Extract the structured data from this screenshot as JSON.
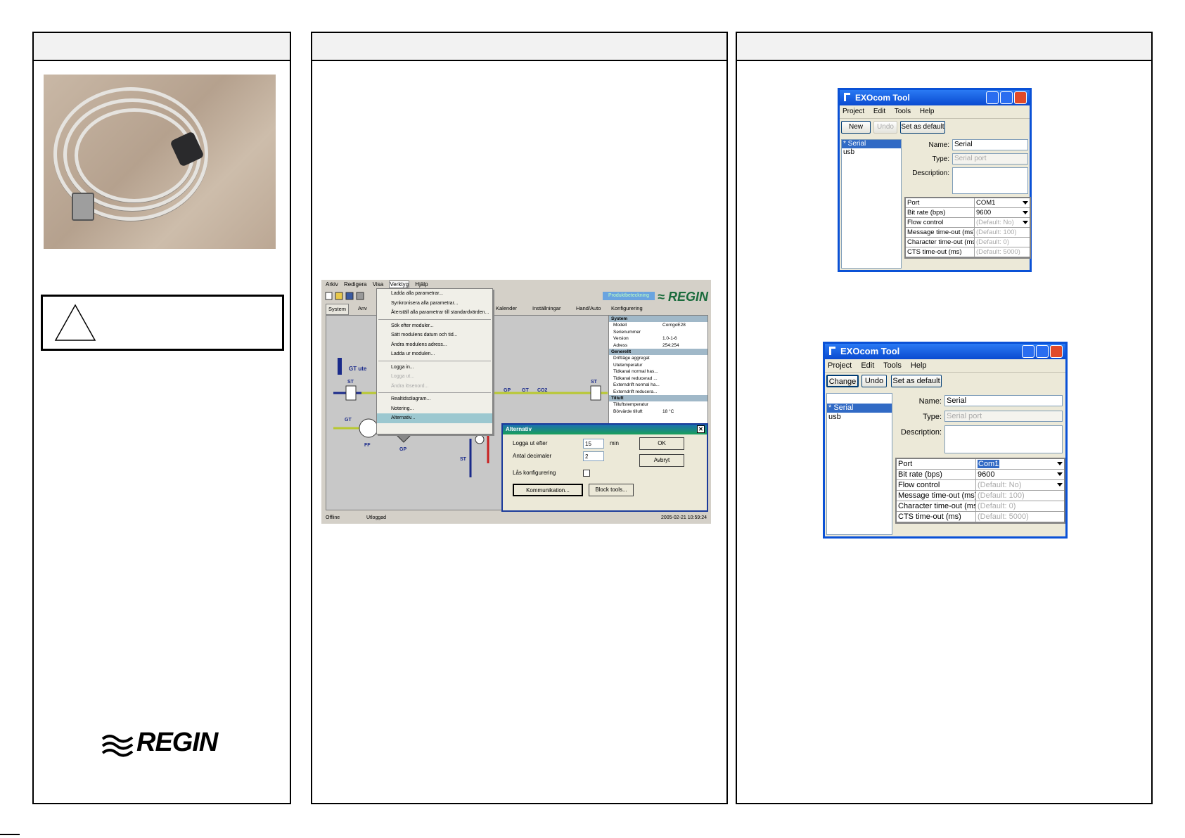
{
  "logo": {
    "text": "REGIN"
  },
  "software": {
    "menu": [
      "Arkiv",
      "Redigera",
      "Visa",
      "Verktyg",
      "Hjälp"
    ],
    "brand_tag": "Produktbeteckning",
    "brand": "REGIN",
    "tabs": [
      "System",
      "Anv",
      "Kalender",
      "Inställningar",
      "Hand/Auto",
      "Konfigurering"
    ],
    "dropdown": [
      {
        "label": "Ladda alla parametrar...",
        "disabled": false
      },
      {
        "label": "Synkronisera alla parametrar...",
        "disabled": false
      },
      {
        "label": "Återställ alla parametrar till standardvärden...",
        "disabled": false
      },
      {
        "label": "Sök efter moduler...",
        "disabled": false
      },
      {
        "label": "Sätt modulens datum och tid...",
        "disabled": false
      },
      {
        "label": "Ändra modulens adress...",
        "disabled": false
      },
      {
        "label": "Ladda ur modulen...",
        "disabled": false
      },
      {
        "label": "Logga in...",
        "disabled": false
      },
      {
        "label": "Logga ut...",
        "disabled": true
      },
      {
        "label": "Ändra lösenord...",
        "disabled": true
      },
      {
        "label": "Realtidsdiagram...",
        "disabled": false
      },
      {
        "label": "Notering...",
        "disabled": false
      },
      {
        "label": "Alternativ...",
        "disabled": false
      }
    ],
    "sidebar": {
      "system_header": "System",
      "system_rows": [
        [
          "Modell",
          "CorrigoE28"
        ],
        [
          "Serienummer",
          ""
        ],
        [
          "Version",
          "1.0-1-6"
        ],
        [
          "Adress",
          "254:254"
        ]
      ],
      "general_header": "Generellt",
      "general_rows": [
        "Driftläge aggregat",
        "Utetemperatur",
        "Tidkanal normal has...",
        "Tidkanal reducerad ...",
        "Externdrift normal ha...",
        "Externdrift reducera..."
      ],
      "tilluft_header": "Tilluft",
      "tilluft_rows": [
        [
          "Tilluftstemperatur",
          ""
        ],
        [
          "Börvärde tilluft",
          "18 °C"
        ]
      ]
    },
    "diagram_labels": [
      "GT ute",
      "ST",
      "GP",
      "GT",
      "CO2",
      "ST",
      "GT",
      "FF",
      "GP",
      "ST"
    ],
    "dialog": {
      "title": "Alternativ",
      "logout_label": "Logga ut efter",
      "logout_value": "15",
      "logout_unit": "min",
      "decimals_label": "Antal decimaler",
      "decimals_value": "2",
      "lock_label": "Lås konfigurering",
      "ok": "OK",
      "cancel": "Avbryt",
      "comm": "Kommunikation...",
      "block": "Block tools..."
    },
    "status": {
      "left": "Offline",
      "mid": "Utloggad",
      "right": "2005-02-21  10:59:24"
    }
  },
  "exocom1": {
    "title": "EXOcom Tool",
    "menu": [
      "Project",
      "Edit",
      "Tools",
      "Help"
    ],
    "btn_new": "New",
    "btn_undo": "Undo",
    "btn_default": "Set as default",
    "list": [
      "* Serial",
      "usb"
    ],
    "name_label": "Name:",
    "name_value": "Serial",
    "type_label": "Type:",
    "type_value": "Serial port",
    "desc_label": "Description:",
    "rows": [
      {
        "k": "Port",
        "v": "COM1",
        "dd": true,
        "dis": false
      },
      {
        "k": "Bit rate (bps)",
        "v": "9600",
        "dd": true,
        "dis": false
      },
      {
        "k": "Flow control",
        "v": "(Default: No)",
        "dd": true,
        "dis": true
      },
      {
        "k": "Message time-out (ms)",
        "v": "(Default: 100)",
        "dd": false,
        "dis": true
      },
      {
        "k": "Character time-out (ms)",
        "v": "(Default: 0)",
        "dd": false,
        "dis": true
      },
      {
        "k": "CTS time-out (ms)",
        "v": "(Default: 5000)",
        "dd": false,
        "dis": true
      }
    ]
  },
  "exocom2": {
    "title": "EXOcom Tool",
    "menu": [
      "Project",
      "Edit",
      "Tools",
      "Help"
    ],
    "btn_change": "Change",
    "btn_undo": "Undo",
    "btn_default": "Set as default",
    "list": [
      "* Serial",
      "usb"
    ],
    "name_label": "Name:",
    "name_value": "Serial",
    "type_label": "Type:",
    "type_value": "Serial port",
    "desc_label": "Description:",
    "rows": [
      {
        "k": "Port",
        "v": "Com1",
        "dd": true,
        "dis": false,
        "hl": true
      },
      {
        "k": "Bit rate (bps)",
        "v": "9600",
        "dd": true,
        "dis": false
      },
      {
        "k": "Flow control",
        "v": "(Default: No)",
        "dd": true,
        "dis": true
      },
      {
        "k": "Message time-out (ms)",
        "v": "(Default: 100)",
        "dd": false,
        "dis": true
      },
      {
        "k": "Character time-out (ms)",
        "v": "(Default: 0)",
        "dd": false,
        "dis": true
      },
      {
        "k": "CTS time-out (ms)",
        "v": "(Default: 5000)",
        "dd": false,
        "dis": true
      }
    ]
  }
}
